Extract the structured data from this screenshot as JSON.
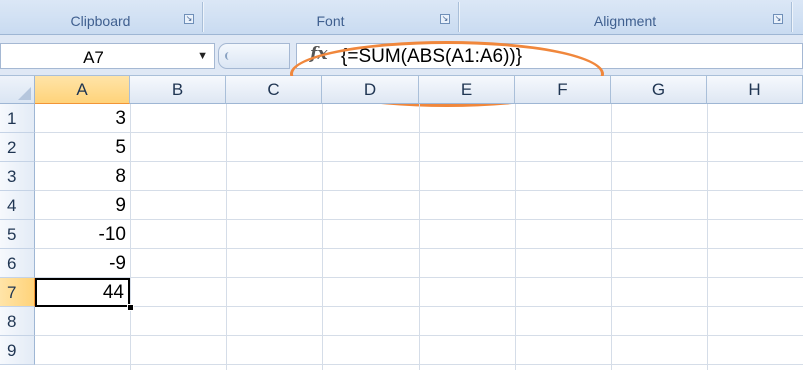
{
  "ribbon": {
    "groups": [
      {
        "label": "Clipboard"
      },
      {
        "label": "Font"
      },
      {
        "label": "Alignment"
      }
    ]
  },
  "formula_bar": {
    "name_box": "A7",
    "fx_icon": "fx",
    "formula": "{=SUM(ABS(A1:A6))}",
    "highlight_color": "#f0873c"
  },
  "sheet": {
    "columns": [
      "A",
      "B",
      "C",
      "D",
      "E",
      "F",
      "G",
      "H"
    ],
    "rows": [
      "1",
      "2",
      "3",
      "4",
      "5",
      "6",
      "7",
      "8",
      "9"
    ],
    "active_column": "A",
    "active_row": "7",
    "values": [
      "3",
      "5",
      "8",
      "9",
      "-10",
      "-9",
      "44"
    ]
  },
  "colors": {
    "active_header": "#ffd37a",
    "header_border": "#9eb6d4"
  }
}
